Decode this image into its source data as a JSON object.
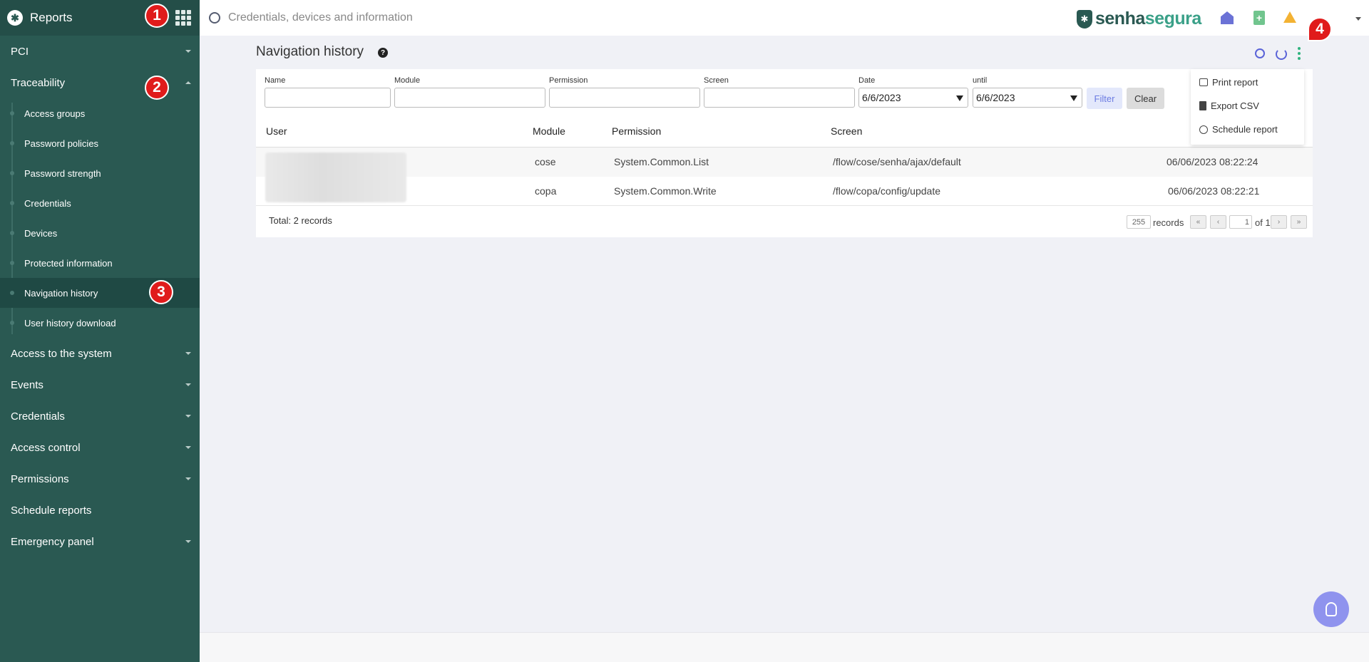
{
  "sidebar": {
    "title": "Reports",
    "items": [
      {
        "label": "PCI"
      },
      {
        "label": "Traceability"
      },
      {
        "label": "Access to the system"
      },
      {
        "label": "Events"
      },
      {
        "label": "Credentials"
      },
      {
        "label": "Access control"
      },
      {
        "label": "Permissions"
      },
      {
        "label": "Schedule reports"
      },
      {
        "label": "Emergency panel"
      }
    ],
    "subitems": [
      {
        "label": "Access groups"
      },
      {
        "label": "Password policies"
      },
      {
        "label": "Password strength"
      },
      {
        "label": "Credentials"
      },
      {
        "label": "Devices"
      },
      {
        "label": "Protected information"
      },
      {
        "label": "Navigation history"
      },
      {
        "label": "User history download"
      }
    ]
  },
  "badges": [
    "1",
    "2",
    "3",
    "4"
  ],
  "topbar": {
    "search_placeholder": "Credentials, devices and information",
    "brand_a": "senha",
    "brand_b": "segura"
  },
  "page": {
    "title": "Navigation history"
  },
  "filters": {
    "name_label": "Name",
    "module_label": "Module",
    "permission_label": "Permission",
    "screen_label": "Screen",
    "date_label": "Date",
    "until_label": "until",
    "date_value": "6/6/2023",
    "until_value": "6/6/2023",
    "filter_button": "Filter",
    "clear_button": "Clear"
  },
  "menu": {
    "print": "Print report",
    "export": "Export CSV",
    "schedule": "Schedule report"
  },
  "table": {
    "headers": {
      "user": "User",
      "module": "Module",
      "permission": "Permission",
      "screen": "Screen"
    },
    "rows": [
      {
        "module": "cose",
        "permission": "System.Common.List",
        "screen": "/flow/cose/senha/ajax/default",
        "date": "06/06/2023 08:22:24"
      },
      {
        "module": "copa",
        "permission": "System.Common.Write",
        "screen": "/flow/copa/config/update",
        "date": "06/06/2023 08:22:21"
      }
    ],
    "total": "Total: 2 records",
    "per_page": "255",
    "records_label": "records",
    "page_number": "1",
    "of_label": "of 1",
    "pager": {
      "first": "«",
      "prev": "‹",
      "next": "›",
      "last": "»"
    }
  },
  "colors": {
    "sidebar": "#2a5952",
    "accent": "#5a63d8",
    "badge": "#e01b1b"
  }
}
